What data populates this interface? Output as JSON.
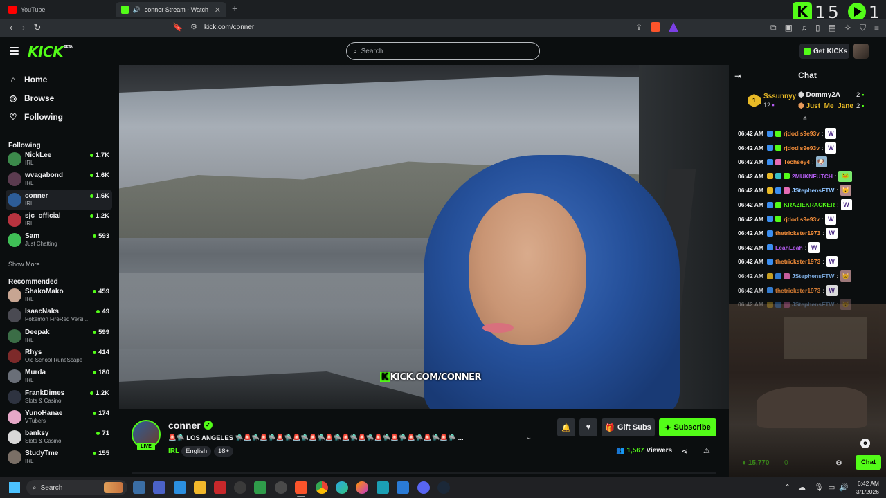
{
  "browser": {
    "tabs": [
      {
        "label": "YouTube",
        "active": false
      },
      {
        "label": "conner Stream - Watch Live o",
        "active": true
      }
    ],
    "url": "kick.com/conner",
    "overlay_counter": {
      "left_value": "15",
      "right_value": "1"
    }
  },
  "header": {
    "logo": "KICK",
    "logo_badge": "BETA",
    "search_placeholder": "Search",
    "get_kicks_label": "Get KICKs"
  },
  "sidebar": {
    "nav": [
      {
        "label": "Home",
        "icon": "home-icon"
      },
      {
        "label": "Browse",
        "icon": "compass-icon"
      },
      {
        "label": "Following",
        "icon": "heart-icon"
      }
    ],
    "following_heading": "Following",
    "following": [
      {
        "name": "NickLee",
        "category": "IRL",
        "viewers": "1.7K",
        "color": "#3c8a4b"
      },
      {
        "name": "wvagabond",
        "category": "IRL",
        "viewers": "1.6K",
        "color": "#5b3b4f"
      },
      {
        "name": "conner",
        "category": "IRL",
        "viewers": "1.6K",
        "color": "#2d5d98",
        "selected": true
      },
      {
        "name": "sjc_official",
        "category": "IRL",
        "viewers": "1.2K",
        "color": "#b8333f"
      },
      {
        "name": "Sam",
        "category": "Just Chatting",
        "viewers": "593",
        "color": "#3fbf56"
      }
    ],
    "show_more": "Show More",
    "recommended_heading": "Recommended",
    "recommended": [
      {
        "name": "ShakoMako",
        "category": "IRL",
        "viewers": "459",
        "color": "#c7a592"
      },
      {
        "name": "IsaacNaks",
        "category": "Pokemon FireRed Versi...",
        "viewers": "49",
        "color": "#4a4a52"
      },
      {
        "name": "Deepak",
        "category": "IRL",
        "viewers": "599",
        "color": "#3b6d46"
      },
      {
        "name": "Rhys",
        "category": "Old School RuneScape",
        "viewers": "414",
        "color": "#7d2a2a"
      },
      {
        "name": "Murda",
        "category": "IRL",
        "viewers": "180",
        "color": "#6a6f78"
      },
      {
        "name": "FrankDimes",
        "category": "Slots & Casino",
        "viewers": "1.2K",
        "color": "#2e3340"
      },
      {
        "name": "YunoHanae",
        "category": "VTubers",
        "viewers": "174",
        "color": "#e6a8c8"
      },
      {
        "name": "banksy",
        "category": "Slots & Casino",
        "viewers": "71",
        "color": "#d8d8d8"
      },
      {
        "name": "StudyTme",
        "category": "IRL",
        "viewers": "155",
        "color": "#7a6f66"
      }
    ]
  },
  "video": {
    "watermark_k": "K",
    "watermark": "KICK.COM/CONNER"
  },
  "stream": {
    "name": "conner",
    "live_label": "LIVE",
    "title": "🚨🛸 LOS ANGELES 🛸🚨🛸🚨🛸🚨🛸🚨🛸🚨🛸🚨🛸🚨🛸🚨🛸🚨🛸🚨🛸🚨🛸🚨🛸🚨🛸 ...",
    "category": "IRL",
    "tags": [
      "English",
      "18+"
    ],
    "gift_label": "Gift Subs",
    "subscribe_label": "Subscribe",
    "viewer_count": "1,567",
    "viewers_label": "Viewers"
  },
  "chat": {
    "title": "Chat",
    "top_gifter": {
      "rank": "1",
      "name": "Sssunnyy",
      "count": "12"
    },
    "leaders": [
      {
        "name": "Dommy2A",
        "count": "2"
      },
      {
        "name": "Just_Me_Jane",
        "count": "2"
      }
    ],
    "messages": [
      {
        "time": "06:42 AM",
        "user": "rjdodis9e93v",
        "color": "#f58e3a",
        "badges": [
          "#3b8ef0",
          "#53fc18"
        ],
        "emote": "W"
      },
      {
        "time": "06:42 AM",
        "user": "rjdodis9e93v",
        "color": "#f58e3a",
        "badges": [
          "#3b8ef0",
          "#53fc18"
        ],
        "emote": "W"
      },
      {
        "time": "06:42 AM",
        "user": "Techsey4",
        "color": "#f58e3a",
        "badges": [
          "#3b8ef0",
          "#e66bb5"
        ],
        "emote": "🐶"
      },
      {
        "time": "06:42 AM",
        "user": "2MUKNFUTCH",
        "color": "#b35cf0",
        "badges": [
          "#e8b926",
          "#39c0c8",
          "#53fc18"
        ],
        "emote": "🐸"
      },
      {
        "time": "06:42 AM",
        "user": "JStephensFTW",
        "color": "#8ec3ff",
        "badges": [
          "#e8b926",
          "#3b8ef0",
          "#e66bb5"
        ],
        "emote": "🐱"
      },
      {
        "time": "06:42 AM",
        "user": "KRAZIEKRACKER",
        "color": "#53fc18",
        "badges": [
          "#3b8ef0",
          "#53fc18"
        ],
        "emote": "W"
      },
      {
        "time": "06:42 AM",
        "user": "rjdodis9e93v",
        "color": "#f58e3a",
        "badges": [
          "#3b8ef0",
          "#53fc18"
        ],
        "emote": "W"
      },
      {
        "time": "06:42 AM",
        "user": "thetrickster1973",
        "color": "#f58e3a",
        "badges": [
          "#3b8ef0"
        ],
        "emote": "W"
      },
      {
        "time": "06:42 AM",
        "user": "LeahLeah",
        "color": "#b35cf0",
        "badges": [
          "#3b8ef0"
        ],
        "emote": "W"
      },
      {
        "time": "06:42 AM",
        "user": "thetrickster1973",
        "color": "#f58e3a",
        "badges": [
          "#3b8ef0"
        ],
        "emote": "W"
      },
      {
        "time": "06:42 AM",
        "user": "JStephensFTW",
        "color": "#8ec3ff",
        "badges": [
          "#e8b926",
          "#3b8ef0",
          "#e66bb5"
        ],
        "emote": "🐱"
      },
      {
        "time": "06:42 AM",
        "user": "thetrickster1973",
        "color": "#f58e3a",
        "badges": [
          "#3b8ef0"
        ],
        "emote": "W"
      },
      {
        "time": "06:42 AM",
        "user": "JStephensFTW",
        "color": "#8ec3ff",
        "badges": [
          "#e8b926",
          "#3b8ef0",
          "#e66bb5"
        ],
        "emote": "🐱"
      }
    ],
    "points": "15,770",
    "points_extra": "0",
    "send_label": "Chat"
  },
  "taskbar": {
    "search_label": "Search",
    "time": "6:42 AM",
    "date": "3/1/2026"
  },
  "colors": {
    "accent": "#53fc18",
    "background": "#0b0e0f",
    "panel": "#24272c"
  }
}
